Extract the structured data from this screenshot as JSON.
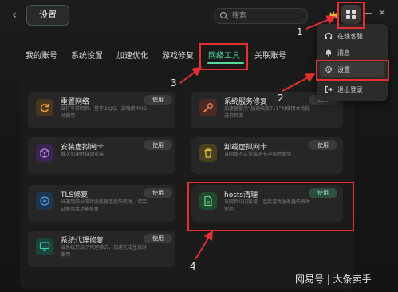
{
  "header": {
    "title": "设置",
    "search_placeholder": "搜索"
  },
  "tabs": [
    {
      "label": "我的账号"
    },
    {
      "label": "系统设置"
    },
    {
      "label": "加速优化"
    },
    {
      "label": "游戏修复"
    },
    {
      "label": "网络工具"
    },
    {
      "label": "关联账号"
    }
  ],
  "active_tab": "网络工具",
  "accent_color": "#53d9a0",
  "tools": [
    {
      "name": "重置网络",
      "desc": "当打不开网页、登不上QQ、游戏跳PING时使用",
      "button": "使用",
      "icon": "reset-network-icon",
      "color": "#b9762a"
    },
    {
      "name": "系统服务修复",
      "desc": "加速器提示“加速失败711”时使用本功能进行检测",
      "button": "使用",
      "icon": "wrench-icon",
      "color": "#b3532f"
    },
    {
      "name": "安装虚拟网卡",
      "desc": "首次加速时自动安装",
      "button": "使用",
      "icon": "cube-icon",
      "color": "#8b48c8"
    },
    {
      "name": "卸载虚拟网卡",
      "desc": "当网络不正常或网卡冲突时使用",
      "button": "使用",
      "icon": "trash-icon",
      "color": "#c1a023"
    },
    {
      "name": "TLS修复",
      "desc": "当遇到部分游戏服务器连接失败时，请尝试使用本功能修复",
      "button": "使用",
      "icon": "tls-icon",
      "color": "#2b6fb8"
    },
    {
      "name": "hosts清理",
      "desc": "当网页访问异常、连接游戏服务器失败时使用",
      "button": "使用",
      "icon": "hosts-file-icon",
      "color": "#3aa85f"
    },
    {
      "name": "系统代理修复",
      "desc": "当系统开启了代理模式，加速无法生效时使用",
      "button": "使用",
      "icon": "monitor-icon",
      "color": "#1f9d86"
    }
  ],
  "menu": {
    "items": [
      {
        "label": "在线客服",
        "icon": "headset-icon"
      },
      {
        "label": "消息",
        "icon": "bell-icon"
      },
      {
        "label": "设置",
        "icon": "gear-icon"
      },
      {
        "label": "退出登录",
        "icon": "logout-icon"
      }
    ]
  },
  "annotations": {
    "n1": "1",
    "n2": "2",
    "n3": "3",
    "n4": "4",
    "color": "#e23030"
  },
  "watermark": "网易号 | 大条卖手"
}
